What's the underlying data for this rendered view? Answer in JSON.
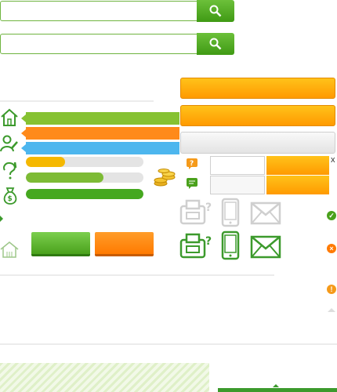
{
  "search": [
    {
      "value": "",
      "placeholder": "",
      "button_icon": "search-icon"
    },
    {
      "value": "",
      "placeholder": "",
      "button_icon": "search-icon"
    }
  ],
  "side_icons": [
    "home-icon",
    "user-edit-icon",
    "question-icon",
    "money-bag-icon"
  ],
  "progress": {
    "bar1": {
      "percent": 33,
      "color": "#f5b800"
    },
    "bar2": {
      "percent": 66,
      "color": "#7dbb35"
    },
    "bar3": {
      "percent": 100,
      "color": "#45a81f"
    }
  },
  "small_inputs": [
    {
      "value": "",
      "placeholder": ""
    },
    {
      "value": "",
      "placeholder": ""
    }
  ],
  "close_label": "x",
  "colors": {
    "brand_green": "#4aa11c",
    "accent_orange": "#ff9a00",
    "accent_blue": "#4db6ee",
    "light_green": "#86c232"
  },
  "device_icons": [
    "fax-icon",
    "mobile-icon",
    "mail-icon"
  ],
  "status_icons": [
    "check-icon",
    "error-icon",
    "warning-icon"
  ]
}
